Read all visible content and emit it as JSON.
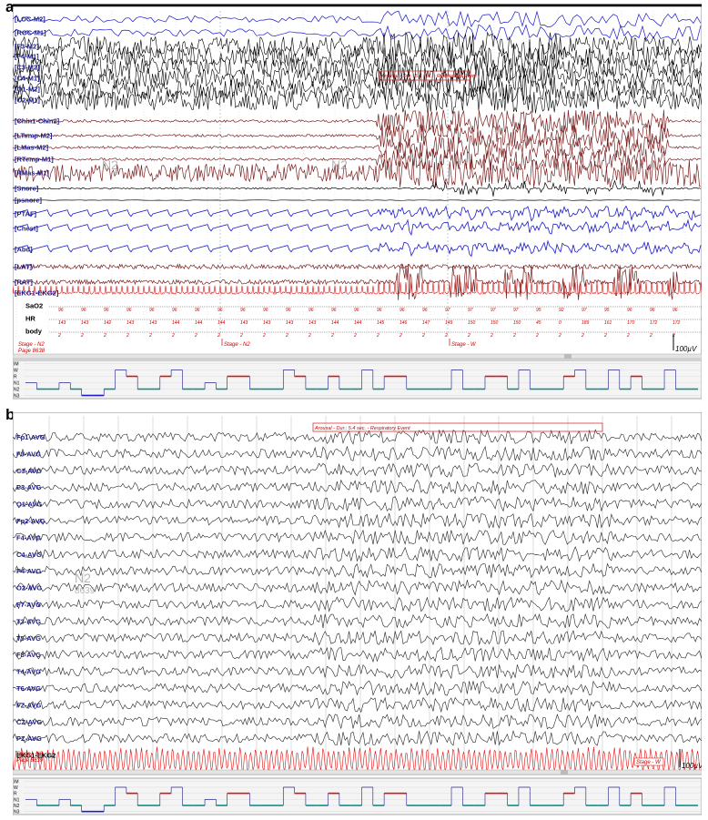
{
  "panel_a": {
    "letter": "a",
    "channels": [
      {
        "label": "[LOC-M2]",
        "color": "#1a1acc"
      },
      {
        "label": "[ROC-M1]",
        "color": "#1a1acc"
      },
      {
        "label": "[F3-M2]",
        "color": "#000000"
      },
      {
        "label": "[F4-M1]",
        "color": "#000000"
      },
      {
        "label": "[C3-M2]",
        "color": "#000000"
      },
      {
        "label": "[C4-M1]",
        "color": "#000000"
      },
      {
        "label": "[O1-M2]",
        "color": "#000000"
      },
      {
        "label": "[O2-M1]",
        "color": "#000000"
      },
      {
        "label": "[Chin1-Chin2]",
        "color": "#7a2020"
      },
      {
        "label": "[LTemp-M2]",
        "color": "#7a2020"
      },
      {
        "label": "[LMas-M2]",
        "color": "#7a2020"
      },
      {
        "label": "[RTemp-M1]",
        "color": "#7a2020"
      },
      {
        "label": "[RMas-M1]",
        "color": "#7a2020"
      },
      {
        "label": "[Snore]",
        "color": "#000000"
      },
      {
        "label": "[psnore]",
        "color": "#000000"
      },
      {
        "label": "[PTAF]",
        "color": "#1a1acc"
      },
      {
        "label": "[Chest]",
        "color": "#1a1acc"
      },
      {
        "label": "[Abd]",
        "color": "#1a1acc"
      },
      {
        "label": "[LAT]",
        "color": "#7a2020"
      },
      {
        "label": "[RAT]",
        "color": "#7a2020"
      },
      {
        "label": "[EKG1-EKG2]",
        "color": "#e01010"
      },
      {
        "label": "SaO2",
        "color": "#000000"
      },
      {
        "label": "HR",
        "color": "#000000"
      },
      {
        "label": "body",
        "color": "#000000"
      }
    ],
    "sao2_values": [
      "96",
      "96",
      "96",
      "96",
      "96",
      "96",
      "96",
      "96",
      "96",
      "96",
      "96",
      "96",
      "96",
      "96",
      "96",
      "96",
      "96",
      "97",
      "97",
      "97",
      "97",
      "95",
      "92",
      "97",
      "95",
      "96",
      "96",
      "96"
    ],
    "hr_values": [
      "143",
      "143",
      "142",
      "143",
      "143",
      "144",
      "144",
      "144",
      "143",
      "143",
      "143",
      "143",
      "144",
      "144",
      "145",
      "146",
      "147",
      "149",
      "150",
      "150",
      "150",
      "45",
      "0",
      "189",
      "161",
      "170",
      "172",
      "172"
    ],
    "body_values": [
      "2",
      "2",
      "2",
      "2",
      "2",
      "2",
      "2",
      "2",
      "2",
      "2",
      "2",
      "2",
      "2",
      "2",
      "2",
      "2",
      "2",
      "2",
      "2",
      "2",
      "2",
      "2",
      "2",
      "2",
      "2",
      "2",
      "2",
      "2"
    ],
    "annotation": "Arousal - Dur.: 5.4 sec. - Respiratory Event",
    "stage_left": "Stage - N2",
    "page_left": "Page 8638",
    "stage_mid": "Stage - N2",
    "stage_right": "Stage - W",
    "watermark_left": "N2",
    "watermark_mid": "N2",
    "scale": "100µV",
    "hypnogram_levels": [
      "IM",
      "W",
      "R",
      "N1",
      "N2",
      "N3"
    ]
  },
  "panel_b": {
    "letter": "b",
    "channels": [
      {
        "label": "Fp1-AVG"
      },
      {
        "label": "F3-AVG"
      },
      {
        "label": "C3-AVG"
      },
      {
        "label": "P3-AVG"
      },
      {
        "label": "O1-AVG"
      },
      {
        "label": "Fp2-AVG"
      },
      {
        "label": "F4-AVG"
      },
      {
        "label": "C4-AVG"
      },
      {
        "label": "P4-AVG"
      },
      {
        "label": "O2-AVG"
      },
      {
        "label": "F7-AVG"
      },
      {
        "label": "T3-AVG"
      },
      {
        "label": "T5-AVG"
      },
      {
        "label": "F8-AVG"
      },
      {
        "label": "T4-AVG"
      },
      {
        "label": "T6-AVG"
      },
      {
        "label": "FZ-AVG"
      },
      {
        "label": "CZ-AVG"
      },
      {
        "label": "PZ-AVG"
      },
      {
        "label": "EKG1-EKG2"
      }
    ],
    "annotation": "Arousal - Dur.: 5.4 sec. - Respiratory Event",
    "stage_left": "Stage - N2",
    "page_left": "Page 8639",
    "stage_right": "Stage - W",
    "watermark": "N2",
    "watermark_sub": "8639",
    "scale": "100µV",
    "hypnogram_levels": [
      "IM",
      "W",
      "R",
      "N1",
      "N2",
      "N3"
    ]
  }
}
